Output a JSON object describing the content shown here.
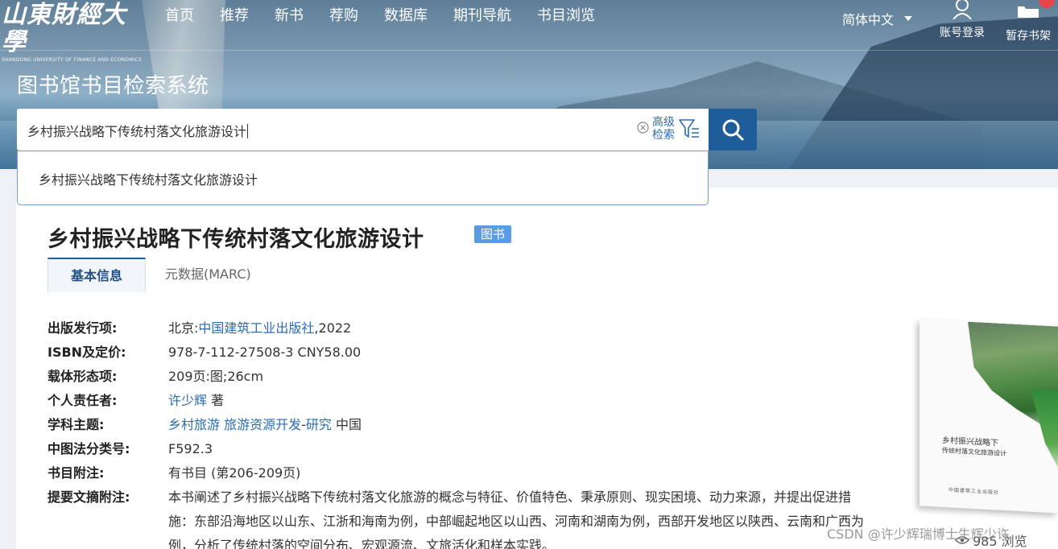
{
  "header": {
    "logo_text": "山東財經大學",
    "logo_sub": "SHANDONG UNIVERSITY OF FINANCE AND ECONOMICS",
    "nav": [
      "首页",
      "推荐",
      "新书",
      "荐购",
      "数据库",
      "期刊导航",
      "书目浏览"
    ],
    "language": "简体中文",
    "login_label": "账号登录",
    "shelf_label": "暂存书架"
  },
  "system_title": "图书馆书目检索系统",
  "search": {
    "query": "乡村振兴战略下传统村落文化旅游设计",
    "advanced_label": "高级检索",
    "suggestion": "乡村振兴战略下传统村落文化旅游设计"
  },
  "book": {
    "title": "乡村振兴战略下传统村落文化旅游设计",
    "type_badge": "图书",
    "tabs": [
      "基本信息",
      "元数据(MARC)"
    ],
    "fields": {
      "publish_label": "出版发行项:",
      "publish_place": "北京:",
      "publisher": "中国建筑工业出版社",
      "publish_year": ",2022",
      "isbn_label": "ISBN及定价:",
      "isbn_value": "978-7-112-27508-3 CNY58.00",
      "form_label": "载体形态项:",
      "form_value": "209页:图;26cm",
      "author_label": "个人责任者:",
      "author": "许少辉",
      "author_role": " 著",
      "subject_label": "学科主题:",
      "subject_1": "乡村旅游",
      "subject_2": "旅游资源开发",
      "subject_sep": "-",
      "subject_3": "研究",
      "subject_region": " 中国",
      "clc_label": "中图法分类号:",
      "clc_value": "F592.3",
      "note_label": "书目附注:",
      "note_value": "有书目 (第206-209页)",
      "abstract_label": "提要文摘附注:",
      "abstract_value": "本书阐述了乡村振兴战略下传统村落文化旅游的概念与特征、价值特色、秉承原则、现实困境、动力来源，并提出促进措施：东部沿海地区以山东、江浙和海南为例，中部崛起地区以山西、河南和湖南为例，西部开发地区以陕西、云南和广西为例，分析了传统村落的空间分布、宏观源流、文旅活化和样本实践。"
    },
    "cover": {
      "title_line1": "乡村振兴战略下",
      "title_line2": "传统村落文化旅游设计",
      "publisher_text": "中国建筑工业出版社"
    },
    "views": "985 浏览"
  },
  "watermark": "CSDN @许少辉瑞博士生辉少许",
  "colors": {
    "primary": "#1f5c9a",
    "link": "#2a6db4",
    "badge": "#5a9be6"
  }
}
